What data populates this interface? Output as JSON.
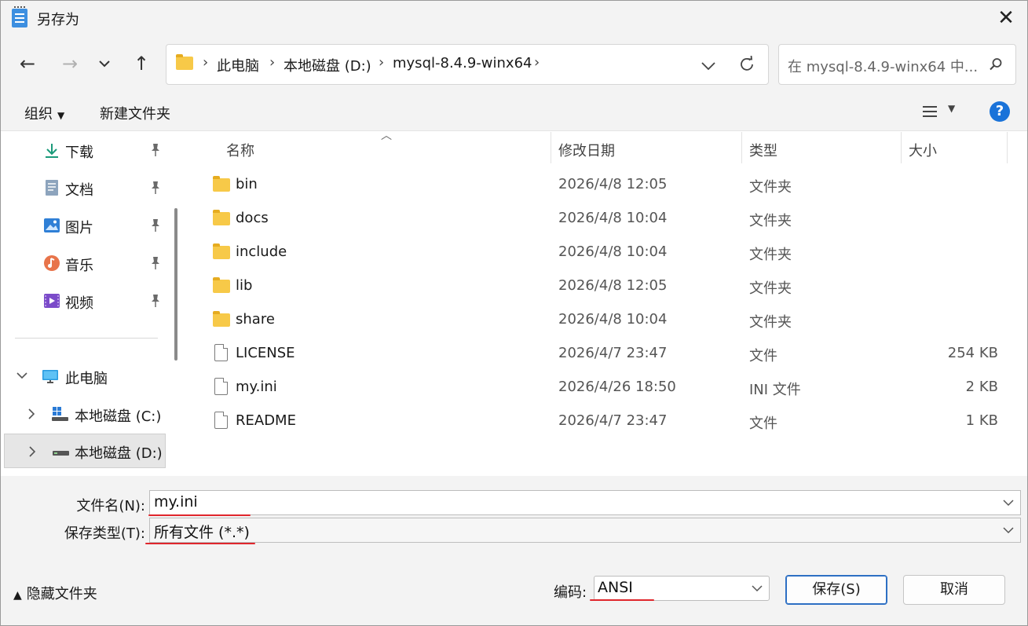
{
  "window": {
    "title": "另存为",
    "close": "✕"
  },
  "nav": {
    "back": "←",
    "forward": "→",
    "recent": "⌄",
    "up": "↑",
    "breadcrumbs": [
      "此电脑",
      "本地磁盘 (D:)",
      "mysql-8.4.9-winx64"
    ],
    "sep": "›",
    "dropdown": "⌵",
    "refresh": "⟳",
    "search_placeholder": "在 mysql-8.4.9-winx64 中..."
  },
  "toolbar": {
    "organize": "组织",
    "new_folder": "新建文件夹",
    "help": "?"
  },
  "sidebar": {
    "quick": [
      {
        "label": "下载",
        "icon": "download-icon"
      },
      {
        "label": "文档",
        "icon": "document-icon"
      },
      {
        "label": "图片",
        "icon": "pictures-icon"
      },
      {
        "label": "音乐",
        "icon": "music-icon"
      },
      {
        "label": "视频",
        "icon": "video-icon"
      }
    ],
    "this_pc": "此电脑",
    "drives": [
      {
        "label": "本地磁盘 (C:)",
        "icon": "windows-drive-icon"
      },
      {
        "label": "本地磁盘 (D:)",
        "icon": "drive-icon"
      }
    ]
  },
  "columns": {
    "name": "名称",
    "date": "修改日期",
    "type": "类型",
    "size": "大小"
  },
  "files": [
    {
      "name": "bin",
      "date": "2026/4/8 12:05",
      "type": "文件夹",
      "size": "",
      "kind": "folder"
    },
    {
      "name": "docs",
      "date": "2026/4/8 10:04",
      "type": "文件夹",
      "size": "",
      "kind": "folder"
    },
    {
      "name": "include",
      "date": "2026/4/8 10:04",
      "type": "文件夹",
      "size": "",
      "kind": "folder"
    },
    {
      "name": "lib",
      "date": "2026/4/8 12:05",
      "type": "文件夹",
      "size": "",
      "kind": "folder"
    },
    {
      "name": "share",
      "date": "2026/4/8 10:04",
      "type": "文件夹",
      "size": "",
      "kind": "folder"
    },
    {
      "name": "LICENSE",
      "date": "2026/4/7 23:47",
      "type": "文件",
      "size": "254 KB",
      "kind": "file"
    },
    {
      "name": "my.ini",
      "date": "2026/4/26 18:50",
      "type": "INI 文件",
      "size": "2 KB",
      "kind": "file"
    },
    {
      "name": "README",
      "date": "2026/4/7 23:47",
      "type": "文件",
      "size": "1 KB",
      "kind": "file"
    }
  ],
  "form": {
    "filename_label": "文件名(N):",
    "filename_value": "my.ini",
    "filetype_label": "保存类型(T):",
    "filetype_value": "所有文件  (*.*)"
  },
  "footer": {
    "hide_folders": "隐藏文件夹",
    "encoding_label": "编码:",
    "encoding_value": "ANSI",
    "save": "保存(S)",
    "cancel": "取消"
  },
  "colors": {
    "accent": "#1a73d9",
    "highlight": "#e0262c",
    "folder": "#f7c948"
  }
}
